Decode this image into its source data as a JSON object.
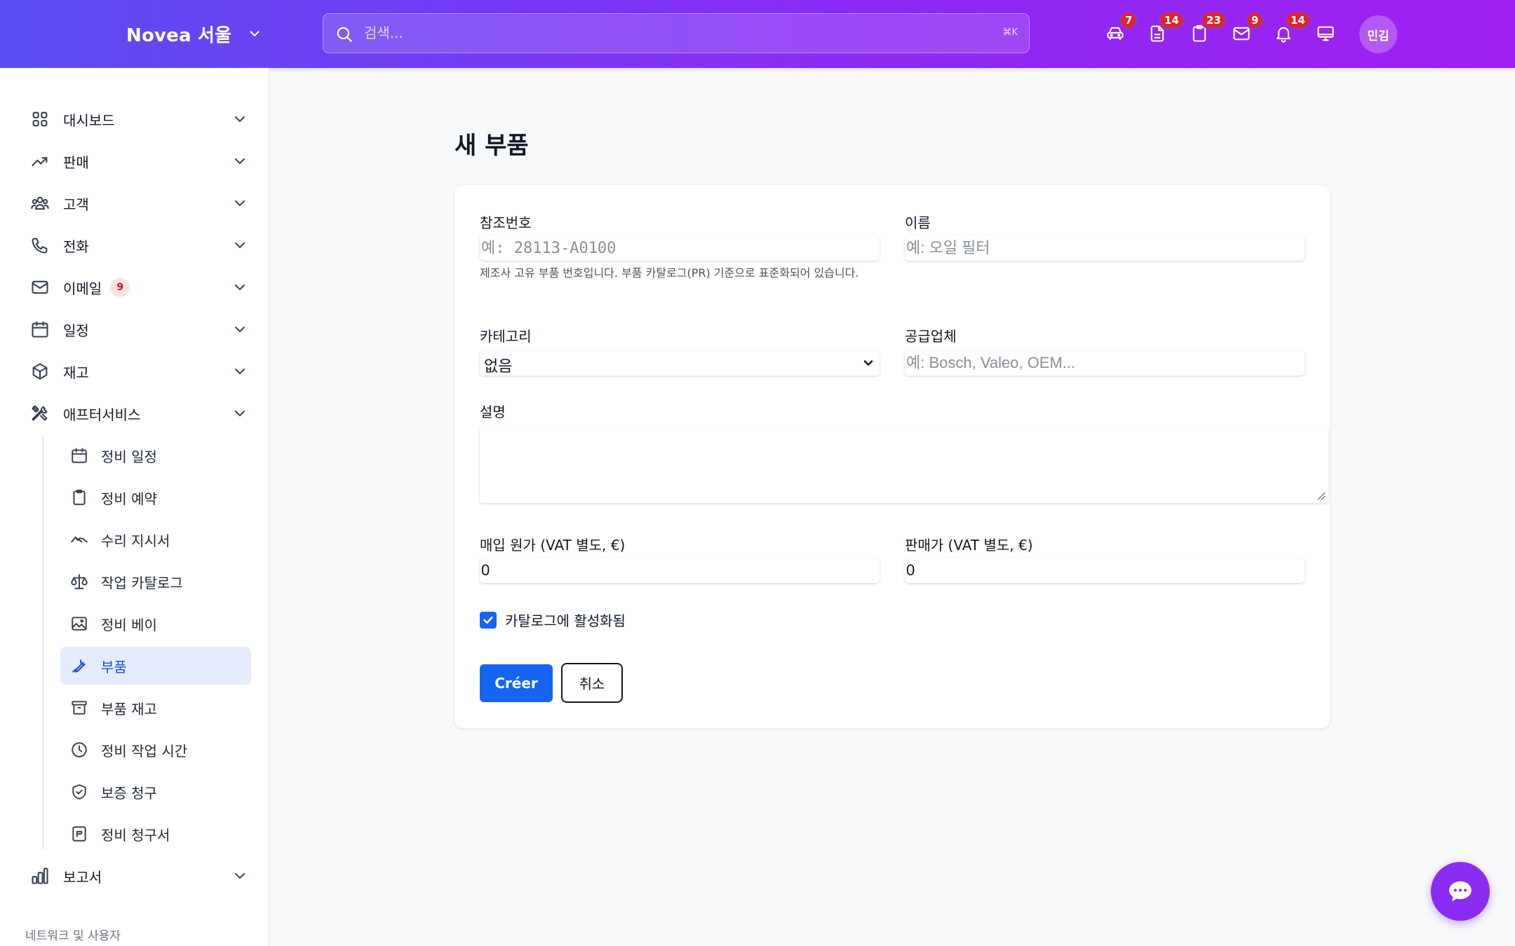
{
  "header": {
    "brand": "Novea 서울",
    "search_placeholder": "검색...",
    "search_shortcut": "⌘K",
    "user_initials": "민김",
    "icons": [
      {
        "name": "car-icon",
        "badge": "7"
      },
      {
        "name": "document-icon",
        "badge": "14"
      },
      {
        "name": "clipboard-icon",
        "badge": "23"
      },
      {
        "name": "mail-icon",
        "badge": "9"
      },
      {
        "name": "bell-icon",
        "badge": "14"
      },
      {
        "name": "monitor-icon",
        "badge": ""
      }
    ]
  },
  "sidebar": {
    "items": [
      {
        "label": "대시보드",
        "icon": "grid-icon"
      },
      {
        "label": "판매",
        "icon": "trending-up-icon"
      },
      {
        "label": "고객",
        "icon": "users-icon"
      },
      {
        "label": "전화",
        "icon": "phone-icon"
      },
      {
        "label": "이메일",
        "icon": "mail-icon",
        "badge": "9"
      },
      {
        "label": "일정",
        "icon": "calendar-icon"
      },
      {
        "label": "재고",
        "icon": "box-icon"
      },
      {
        "label": "애프터서비스",
        "icon": "tools-icon"
      }
    ],
    "subitems": [
      {
        "label": "정비 일정",
        "icon": "calendar-icon"
      },
      {
        "label": "정비 예약",
        "icon": "clipboard-icon"
      },
      {
        "label": "수리 지시서",
        "icon": "handshake-icon"
      },
      {
        "label": "작업 카탈로그",
        "icon": "scale-icon"
      },
      {
        "label": "정비 베이",
        "icon": "image-icon"
      },
      {
        "label": "부품",
        "icon": "wrench-icon",
        "active": true
      },
      {
        "label": "부품 재고",
        "icon": "archive-icon"
      },
      {
        "label": "정비 작업 시간",
        "icon": "clock-icon"
      },
      {
        "label": "보증 청구",
        "icon": "shield-check-icon"
      },
      {
        "label": "정비 청구서",
        "icon": "receipt-icon"
      }
    ],
    "reports": {
      "label": "보고서",
      "icon": "bar-chart-icon"
    },
    "section_label": "네트워크 및 사용자"
  },
  "page": {
    "title": "새 부품"
  },
  "form": {
    "reference_label": "참조번호",
    "reference_placeholder": "예: 28113-A0100",
    "reference_help": "제조사 고유 부품 번호입니다. 부품 카탈로그(PR) 기준으로 표준화되어 있습니다.",
    "name_label": "이름",
    "name_placeholder": "예: 오일 필터",
    "category_label": "카테고리",
    "category_value": "없음",
    "supplier_label": "공급업체",
    "supplier_placeholder": "예: Bosch, Valeo, OEM...",
    "description_label": "설명",
    "cost_label": "매입 원가 (VAT 별도, €)",
    "cost_value": "0",
    "price_label": "판매가 (VAT 별도, €)",
    "price_value": "0",
    "active_label": "카탈로그에 활성화됨",
    "submit_label": "Créer",
    "cancel_label": "취소"
  },
  "colors": {
    "header_start": "#5b4ef2",
    "header_end": "#a020f0",
    "primary": "#1565f0",
    "active_bg": "#e4ecfd",
    "badge": "#e0242f",
    "fab": "#8b2cf3"
  }
}
